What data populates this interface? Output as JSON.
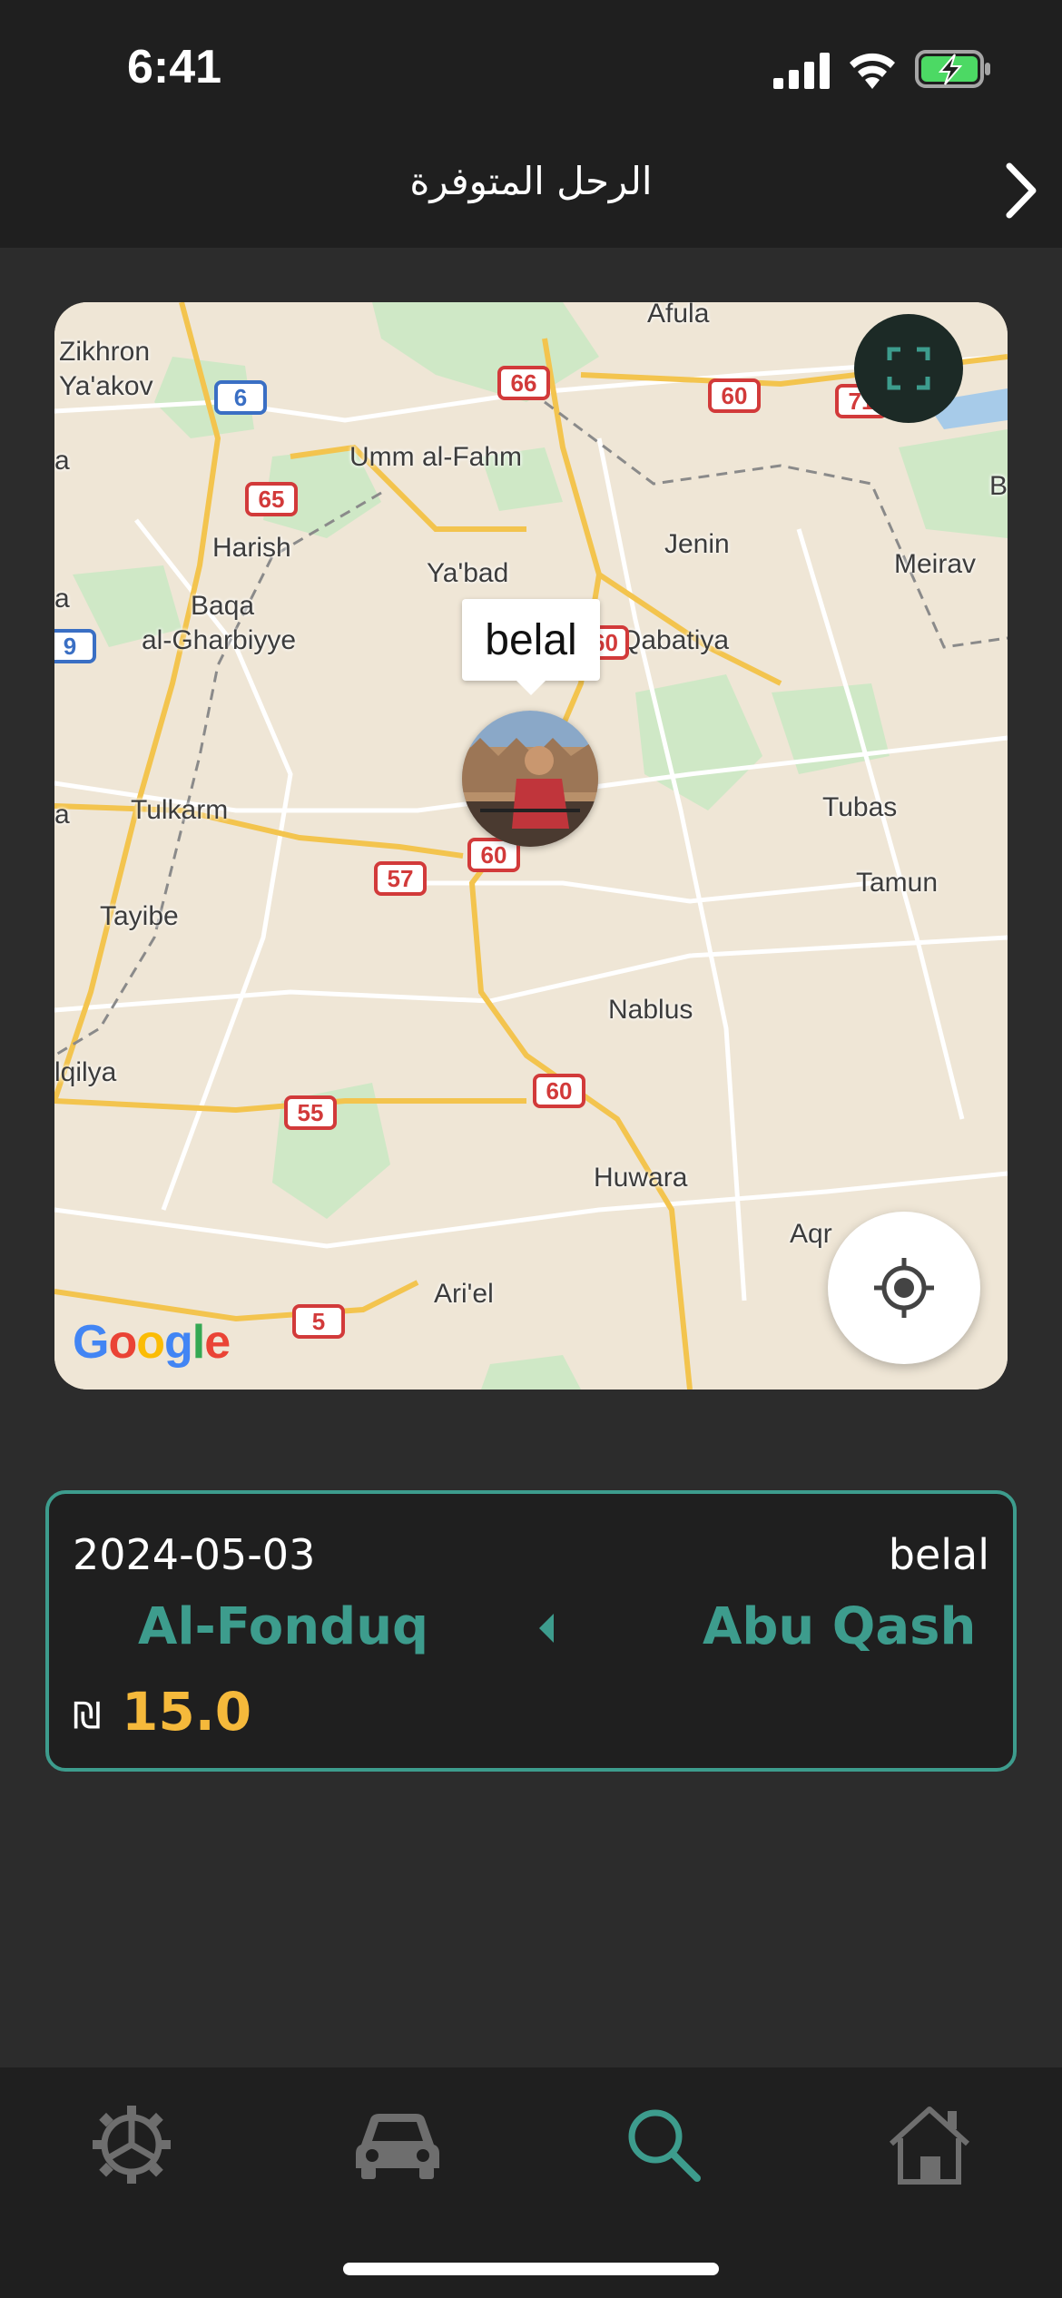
{
  "status_bar": {
    "time": "6:41"
  },
  "header": {
    "title": "الرحل المتوفرة"
  },
  "map": {
    "labels": {
      "zikhron": "Zikhron",
      "yaakov": "Ya'akov",
      "afula": "Afula",
      "umm_al_fahm": "Umm al-Fahm",
      "harish": "Harish",
      "baqa": "Baqa",
      "al_gharbiyye": "al-Gharbiyye",
      "yabad": "Ya'bad",
      "jenin": "Jenin",
      "meirav": "Meirav",
      "qabatiya": "Qabatiya",
      "tulkarm": "Tulkarm",
      "tubas": "Tubas",
      "tamun": "Tamun",
      "tayibe": "Tayibe",
      "nablus": "Nablus",
      "qalqilya": "lqilya",
      "huwara": "Huwara",
      "aqraba": "Aqr",
      "ariel": "Ari'el",
      "edge_a1": "a",
      "edge_a2": "a",
      "edge_a3": "a",
      "edge_b": "B"
    },
    "roads": {
      "r6": "6",
      "r66": "66",
      "r60_top": "60",
      "r71": "71",
      "r65": "65",
      "r9": "9",
      "r60_mid": "60",
      "r57": "57",
      "r60_low": "60",
      "r55": "55",
      "r5": "5"
    },
    "marker": {
      "name": "belal"
    },
    "attribution": "Google"
  },
  "trip": {
    "date": "2024-05-03",
    "driver": "belal",
    "from": "Al-Fonduq",
    "to": "Abu Qash",
    "currency": "₪",
    "price": "15.0"
  },
  "nav": {
    "items": [
      "settings-icon",
      "car-icon",
      "search-icon",
      "home-icon"
    ],
    "active": "search-icon"
  },
  "colors": {
    "accent": "#3d9c8d",
    "price": "#f5b93b",
    "background": "#2c2c2c",
    "bars": "#1f1f1f"
  }
}
